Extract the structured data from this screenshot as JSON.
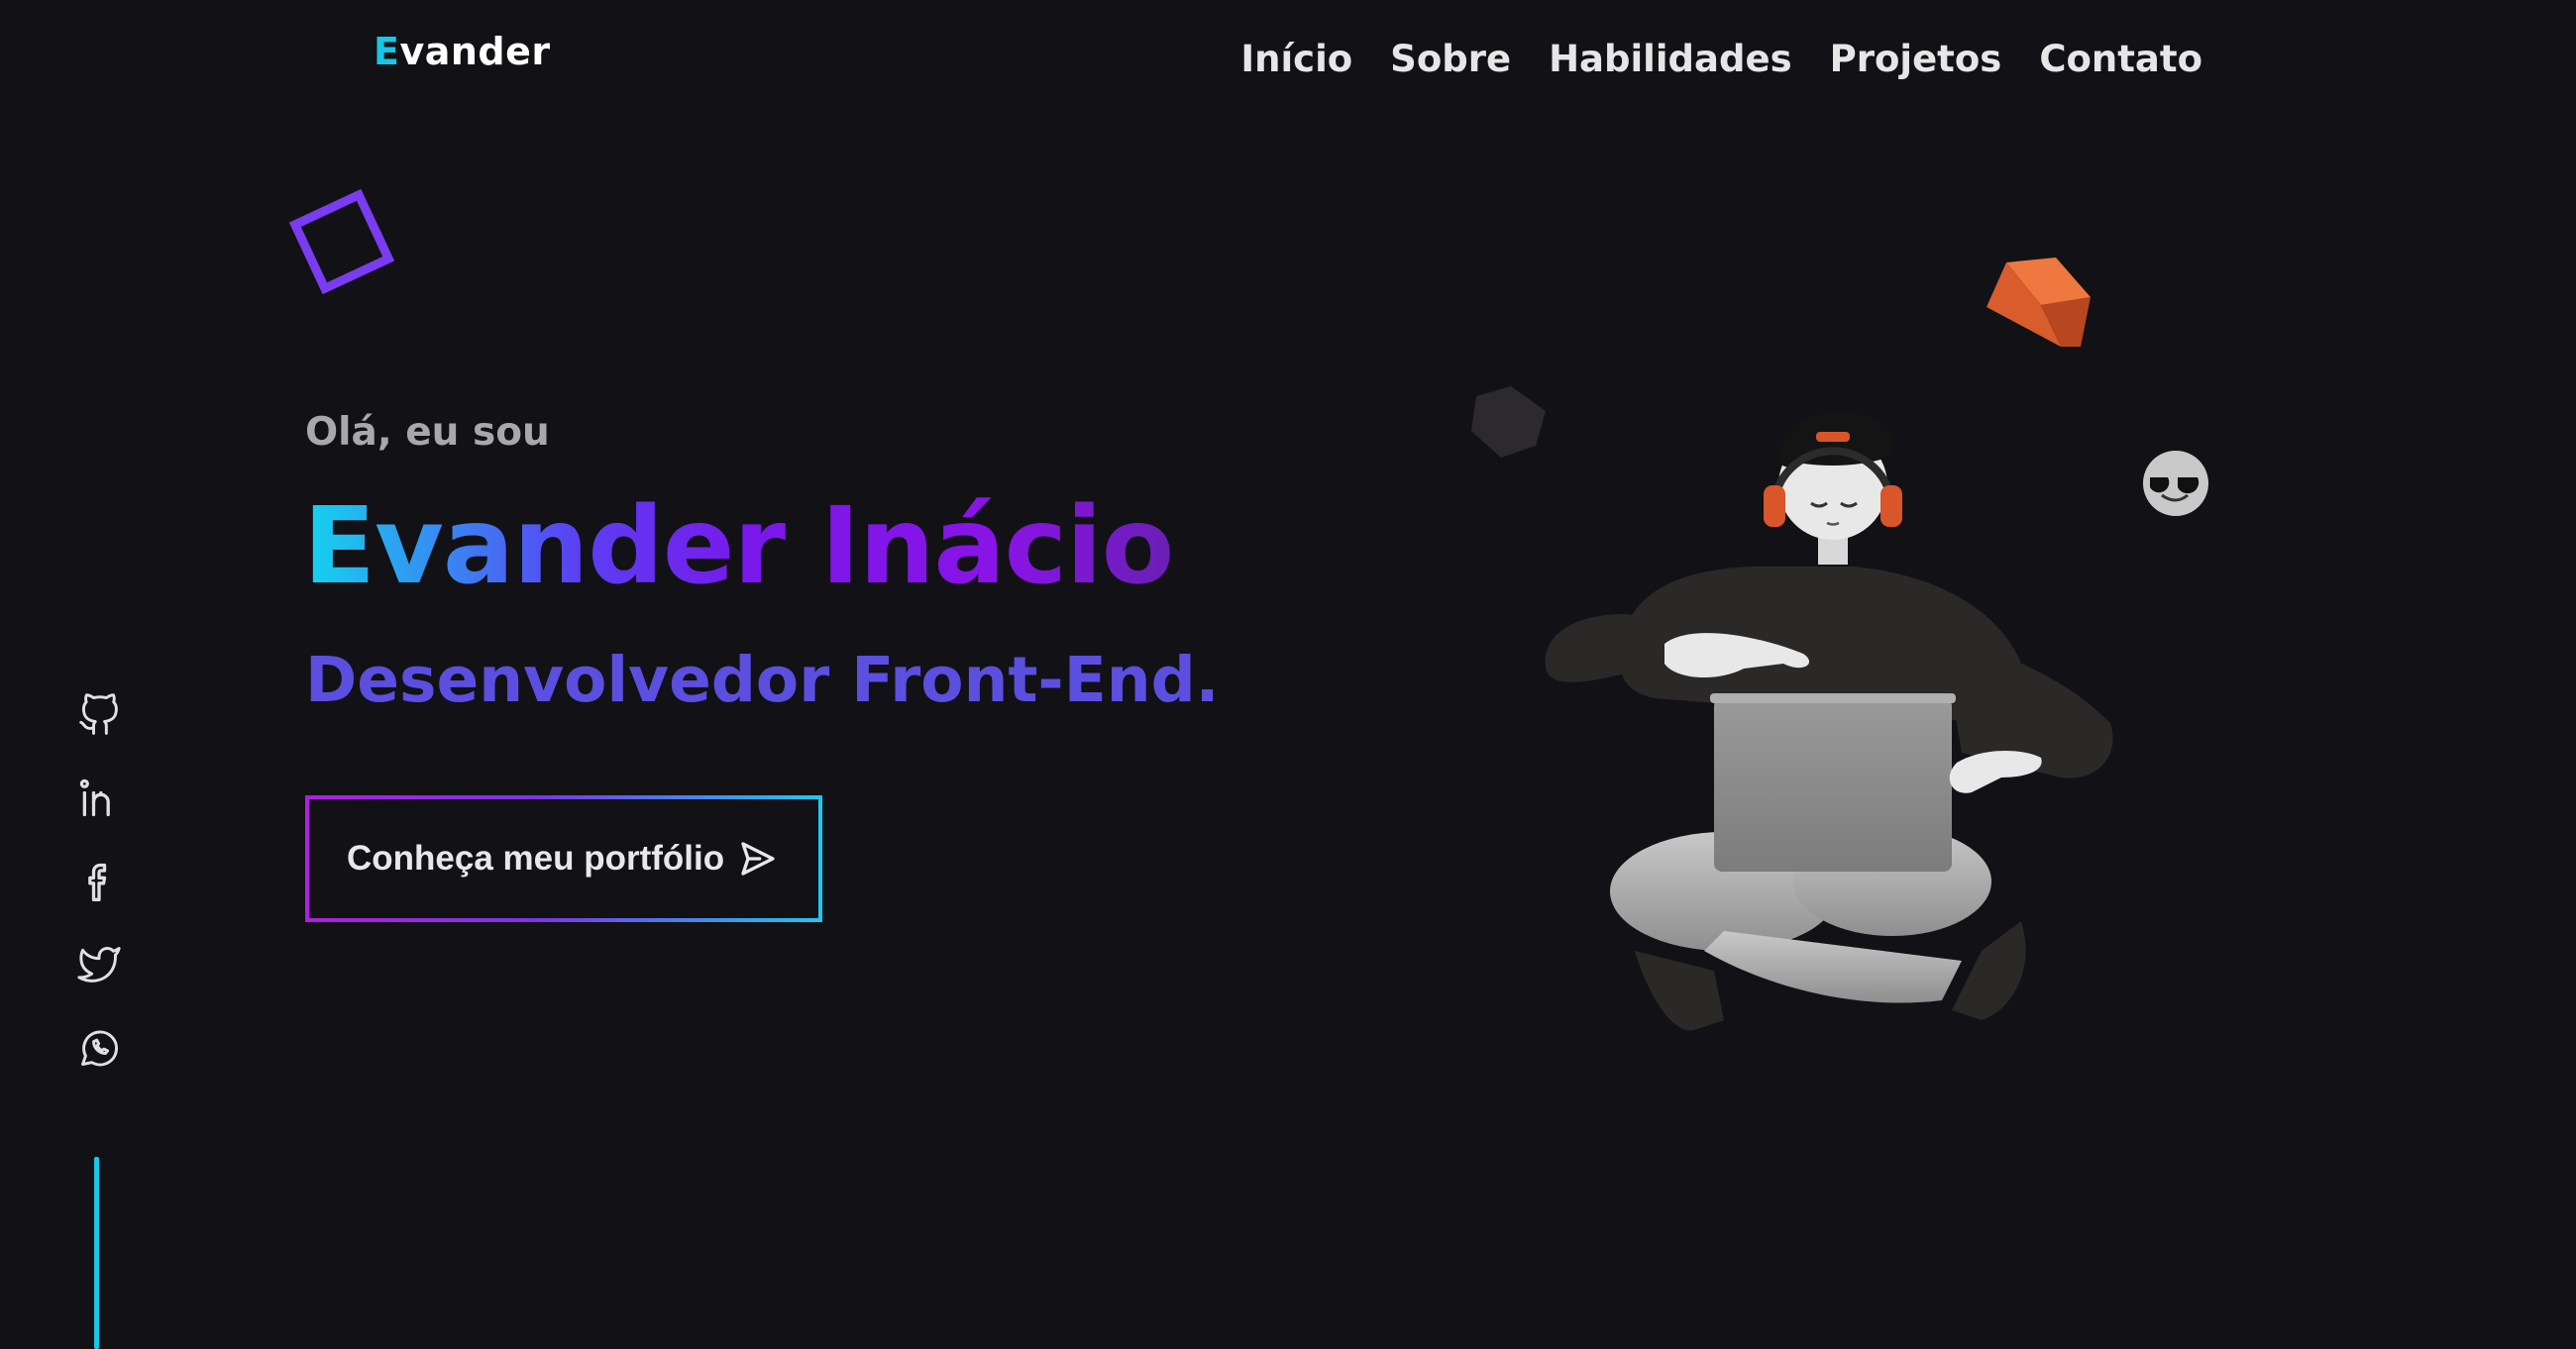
{
  "header": {
    "logo_first_letter": "E",
    "logo_rest": "vander",
    "nav": [
      "Início",
      "Sobre",
      "Habilidades",
      "Projetos",
      "Contato"
    ]
  },
  "hero": {
    "greeting": "Olá, eu sou",
    "name": "Evander Inácio",
    "role": "Desenvolvedor Front-End.",
    "cta_label": "Conheça meu portfólio"
  },
  "social": [
    {
      "icon": "github-icon"
    },
    {
      "icon": "linkedin-icon"
    },
    {
      "icon": "facebook-icon"
    },
    {
      "icon": "twitter-icon"
    },
    {
      "icon": "whatsapp-icon"
    }
  ],
  "colors": {
    "background": "#121116",
    "accent_cyan": "#18c7e6",
    "accent_purple": "#7a17ea",
    "role_color": "#5b4fe0"
  }
}
